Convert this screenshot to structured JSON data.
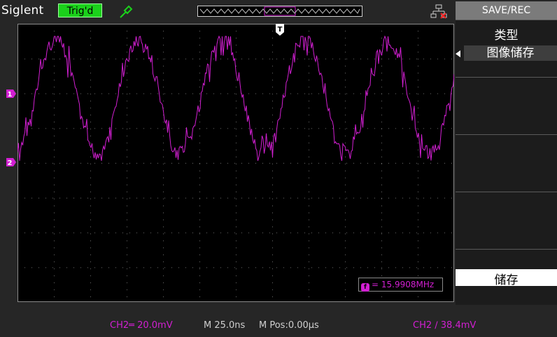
{
  "header": {
    "brand": "Siglent",
    "trigger_status": "Trig'd",
    "trigger_status_color": "#1bd11b",
    "probe_icon": "probe-icon",
    "memory_bar_marker": "T",
    "lan_icon": "lan-disconnected-icon"
  },
  "screen": {
    "trigger_marker": "T",
    "ch1_marker": "1",
    "ch2_marker": "2",
    "trace_color": "#d21fd2",
    "frequency_readout": "= 15.9908MHz",
    "frequency_icon": "f"
  },
  "status_bar": {
    "channel_scale": "CH2═ 20.0mV",
    "timebase": "M 25.0ns",
    "position": "M Pos:0.00µs",
    "trigger": "CH2 ∕ 38.4mV",
    "channel_color": "#d21fd2"
  },
  "menu": {
    "title": "SAVE/REC",
    "type_label": "类型",
    "type_value": "图像储存",
    "save_label": "储存"
  }
}
